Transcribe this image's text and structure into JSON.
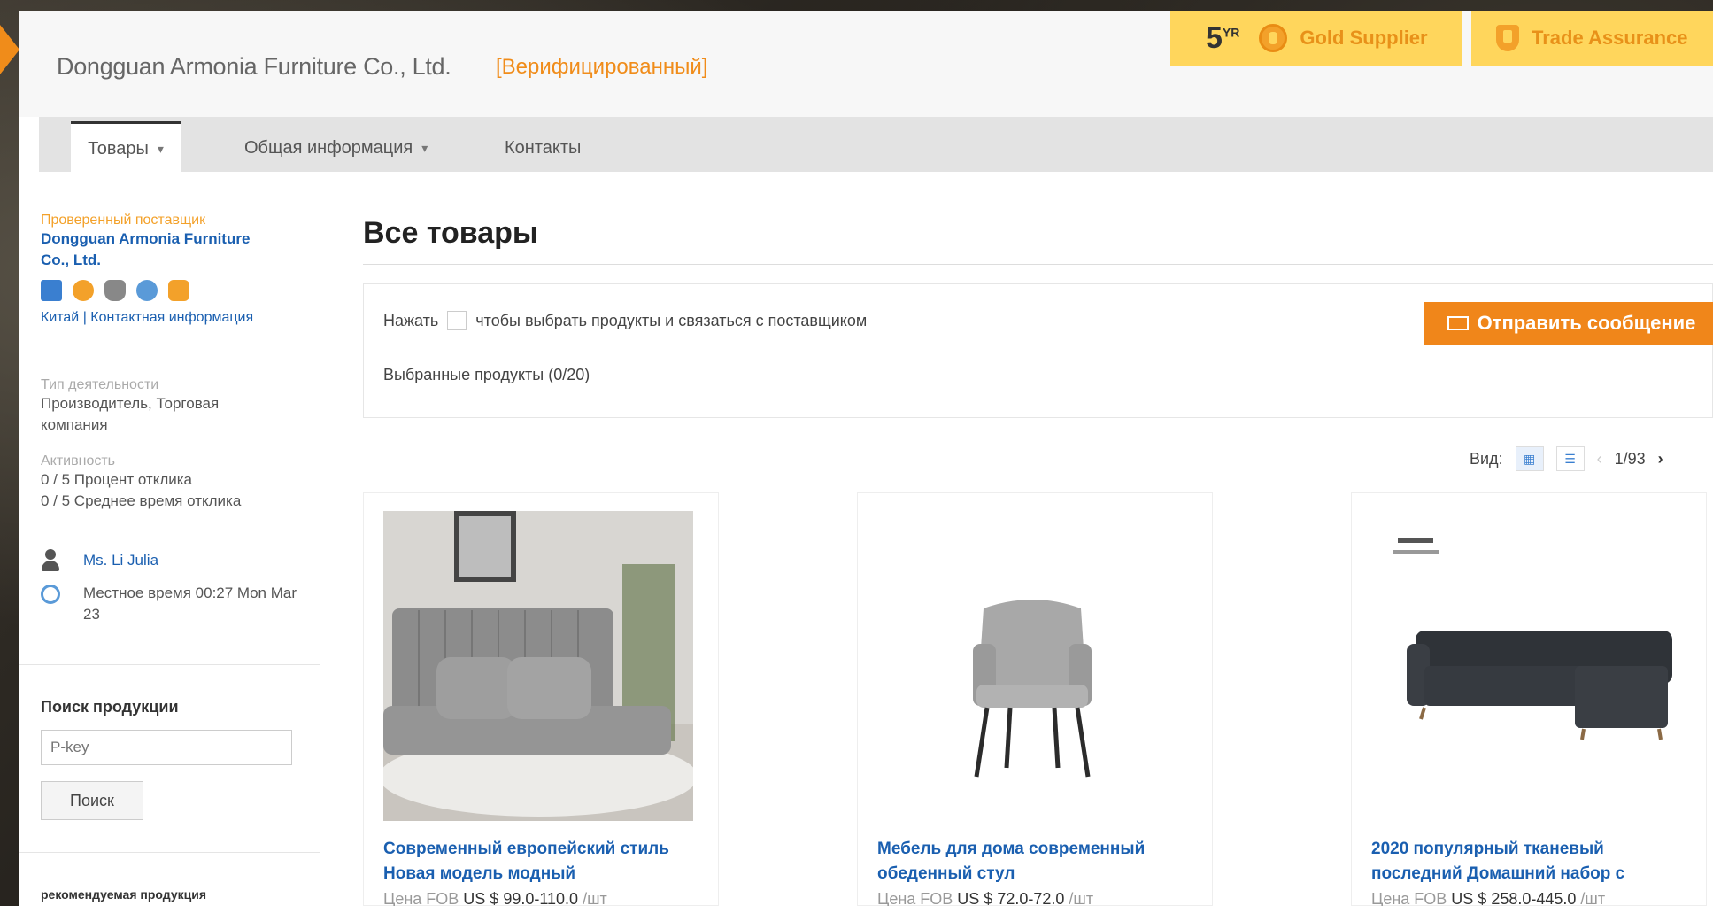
{
  "header": {
    "company_name": "Dongguan Armonia Furniture Co., Ltd.",
    "verified_label": "[Верифицированный]",
    "years": "5",
    "years_suffix": "YR",
    "gold_supplier": "Gold Supplier",
    "trade_assurance": "Trade Assurance"
  },
  "nav": {
    "tabs": [
      {
        "label": "Товары",
        "caret": "▾"
      },
      {
        "label": "Общая информация",
        "caret": "▾"
      },
      {
        "label": "Контакты",
        "caret": ""
      }
    ]
  },
  "sidebar": {
    "supplier_label": "Проверенный поставщик",
    "supplier_name": "Dongguan Armonia Furniture Co., Ltd.",
    "location": "Китай | Контактная информация",
    "business_type_label": "Тип деятельности",
    "business_type": "Производитель, Торговая компания",
    "activity_label": "Активность",
    "response_rate": "0 / 5 Процент отклика",
    "response_time": "0 / 5 Среднее время отклика",
    "contact_name": "Ms. Li Julia",
    "local_time": "Местное время 00:27 Mon Mar 23",
    "search_title": "Поиск продукции",
    "search_placeholder": "P-key",
    "search_button": "Поиск",
    "recommended": "рекомендуемая продукция"
  },
  "main": {
    "title": "Все товары",
    "hint_before": "Нажать",
    "hint_after": "чтобы выбрать продукты и связаться с поставщиком",
    "selected_count": "Выбранные продукты (0/20)",
    "send_button": "Отправить сообщение",
    "view_label": "Вид:",
    "page_indicator": "1/93",
    "products": [
      {
        "title": "Современный европейский стиль Новая модель модный",
        "price_label": "Цена FOB",
        "price": "US $ 99.0-110.0",
        "unit": "/шт"
      },
      {
        "title": "Мебель для дома современный обеденный стул",
        "price_label": "Цена FOB",
        "price": "US $ 72.0-72.0",
        "unit": "/шт"
      },
      {
        "title": "2020 популярный тканевый последний Домашний набор с",
        "price_label": "Цена FOB",
        "price": "US $ 258.0-445.0",
        "unit": "/шт"
      }
    ]
  },
  "colors": {
    "accent_orange": "#f0861a",
    "badge_yellow": "#ffd65c",
    "link_blue": "#1a5fb0"
  }
}
